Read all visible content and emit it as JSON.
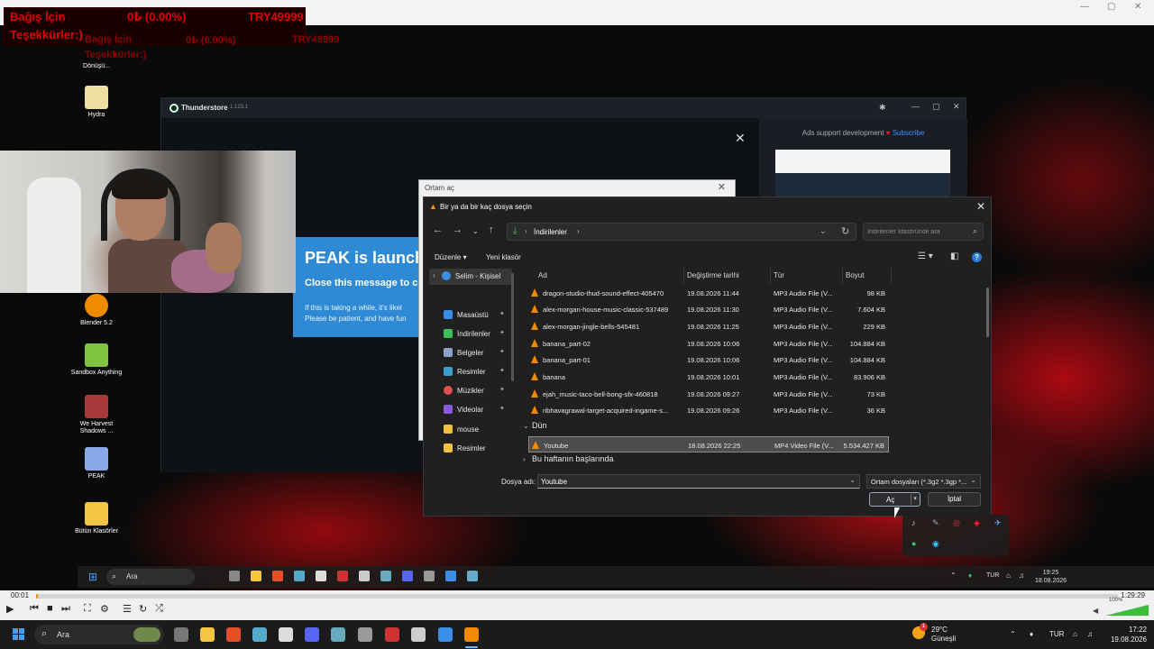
{
  "stream_overlay": {
    "donation_label": "Bağış İçin",
    "donation_label2": "Teşekkürler:)",
    "donation_amount": "0₺ (0.00%)",
    "donation_goal": "TRY49999"
  },
  "desktop": {
    "icons": [
      {
        "label": "Dönüşü..."
      },
      {
        "label": "Hydra"
      },
      {
        "label": "Blender 5.2"
      },
      {
        "label": "Sandbox Anything"
      },
      {
        "label": "We Harvest Shadows ..."
      },
      {
        "label": "PEAK"
      },
      {
        "label": "Bütün Klasörler"
      }
    ]
  },
  "thunderstore": {
    "title": "Thunderstore",
    "version": "1.123.1",
    "ads_text": "Ads support development",
    "subscribe": "Subscribe"
  },
  "peak_splash": {
    "heading": "PEAK is launchi",
    "sub": "Close this message to co",
    "para1": "If this is taking a while, it's likel",
    "para2": "Please be patient, and have fun"
  },
  "vlc_open_dialog": {
    "title": "Ortam aç"
  },
  "file_dialog": {
    "title": "Bir ya da bir kaç dosya seçin",
    "breadcrumb": "İndirilenler",
    "search_placeholder": "İndirilenler klasöründe ara",
    "toolbar": {
      "organize": "Düzenle",
      "new_folder": "Yeni klasör"
    },
    "nav": [
      {
        "label": "Selim - Kişisel",
        "color": "#3a8ee6",
        "pinned": false
      },
      {
        "label": "Masaüstü",
        "color": "#3a8ee6",
        "pinned": true
      },
      {
        "label": "İndirilenler",
        "color": "#3cbf5a",
        "pinned": true
      },
      {
        "label": "Belgeler",
        "color": "#8aa4c8",
        "pinned": true
      },
      {
        "label": "Resimler",
        "color": "#3aa0c8",
        "pinned": true
      },
      {
        "label": "Müzikler",
        "color": "#e05050",
        "pinned": true
      },
      {
        "label": "Videolar",
        "color": "#8a5ad8",
        "pinned": true
      },
      {
        "label": "mouse",
        "color": "#f0c040",
        "pinned": false
      },
      {
        "label": "Resimler",
        "color": "#f0c040",
        "pinned": false
      }
    ],
    "columns": {
      "name": "Ad",
      "modified": "Değiştirme tarihi",
      "type": "Tür",
      "size": "Boyut"
    },
    "groups": {
      "yesterday": "Dün",
      "this_week": "Bu haftanın başlarında"
    },
    "files": [
      {
        "name": "dragon-studio-thud-sound-effect-405470",
        "modified": "19.08.2026 11:44",
        "type": "MP3 Audio File (V...",
        "size": "98 KB"
      },
      {
        "name": "alex-morgan-house-music-classic-537489",
        "modified": "19.08.2026 11:30",
        "type": "MP3 Audio File (V...",
        "size": "7.604 KB"
      },
      {
        "name": "alex-morgan-jingle-bells-545481",
        "modified": "19.08.2026 11:25",
        "type": "MP3 Audio File (V...",
        "size": "229 KB"
      },
      {
        "name": "banana_part-02",
        "modified": "19.08.2026 10:06",
        "type": "MP3 Audio File (V...",
        "size": "104.884 KB"
      },
      {
        "name": "banana_part-01",
        "modified": "19.08.2026 10:06",
        "type": "MP3 Audio File (V...",
        "size": "104.884 KB"
      },
      {
        "name": "banana",
        "modified": "19.08.2026 10:01",
        "type": "MP3 Audio File (V...",
        "size": "83.906 KB"
      },
      {
        "name": "ejah_music-taco-bell-bong-sfx-460818",
        "modified": "19.08.2026 09:27",
        "type": "MP3 Audio File (V...",
        "size": "73 KB"
      },
      {
        "name": "ribhavagrawal-target-acquired-ingame-s...",
        "modified": "19.08.2026 09:26",
        "type": "MP3 Audio File (V...",
        "size": "36 KB"
      }
    ],
    "yesterday_files": [
      {
        "name": "Youtube",
        "modified": "18.08.2026 22:25",
        "type": "MP4 Video File (V...",
        "size": "5.534.427 KB"
      }
    ],
    "filename_label": "Dosya adı:",
    "filename_value": "Youtube",
    "filetype_value": "Ortam dosyaları (*.3g2 *.3gp *...",
    "open_label": "Aç",
    "cancel_label": "İptal"
  },
  "inner_taskbar": {
    "search": "Ara",
    "lang": "TUR",
    "time": "19:25",
    "date": "18.08.2026"
  },
  "vlc_player": {
    "elapsed": "00:01",
    "total": "1:29:29",
    "progress": 0.001,
    "volume": 100,
    "volume_label": "100%"
  },
  "taskbar": {
    "search": "Ara",
    "weather_temp": "29°C",
    "weather_cond": "Güneşli",
    "weather_badge": "1",
    "lang": "TUR",
    "time": "17:22",
    "date": "19.08.2026"
  }
}
